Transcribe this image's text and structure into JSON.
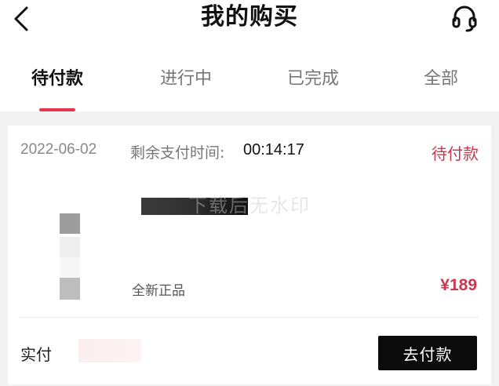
{
  "header": {
    "title": "我的购买",
    "back_icon": "chevron-left-icon",
    "support_icon": "headset-icon"
  },
  "tabs": [
    {
      "label": "待付款",
      "active": true
    },
    {
      "label": "进行中",
      "active": false
    },
    {
      "label": "已完成",
      "active": false
    },
    {
      "label": "全部",
      "active": false
    }
  ],
  "colors": {
    "accent": "#e4364b",
    "price": "#c8384f",
    "button_bg": "#0b0b0b"
  },
  "order": {
    "date": "2022-06-02",
    "remaining_label": "剩余支付时间:",
    "remaining_time": "00:14:17",
    "status": "待付款",
    "watermark": "下载后无水印",
    "product_tag": "全新正品",
    "price": "¥189",
    "paid_label": "实付",
    "pay_button_label": "去付款"
  }
}
